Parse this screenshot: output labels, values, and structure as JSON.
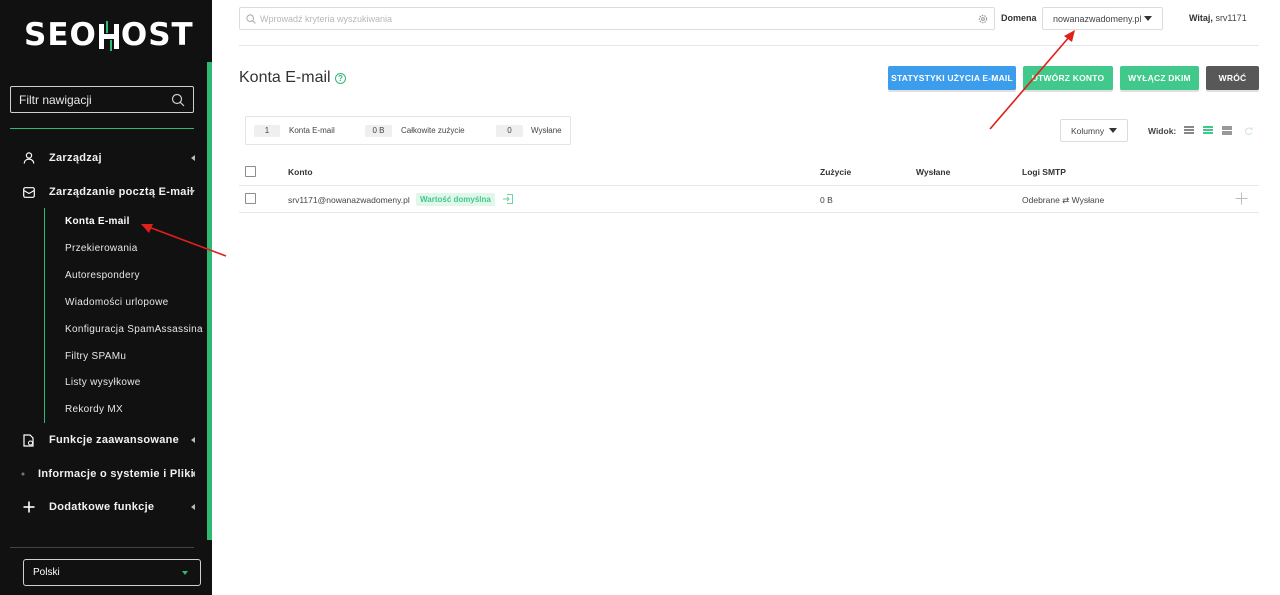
{
  "brand": {
    "logo_left": "SEO",
    "logo_right": "OST",
    "accent": "#2eb872"
  },
  "sidebar": {
    "filter_placeholder": "Filtr nawigacji",
    "items": [
      {
        "label": "Zarządzaj",
        "icon": "user-icon"
      },
      {
        "label": "Zarządzanie pocztą E-mail",
        "icon": "envelope-icon",
        "expanded": true
      },
      {
        "label": "Funkcje zaawansowane",
        "icon": "file-gear-icon"
      },
      {
        "label": "Informacje o systemie i Pliki",
        "icon": "dot-icon"
      },
      {
        "label": "Dodatkowe funkcje",
        "icon": "plus-icon"
      }
    ],
    "submenu": [
      "Konta E-mail",
      "Przekierowania",
      "Autorespondery",
      "Wiadomości urlopowe",
      "Konfiguracja SpamAssassina",
      "Filtry SPAMu",
      "Listy wysyłkowe",
      "Rekordy MX"
    ],
    "active_submenu": "Konta E-mail",
    "language": "Polski"
  },
  "topbar": {
    "search_placeholder": "Wprowadź kryteria wyszukiwania",
    "domain_label": "Domena",
    "domain_value": "nowanazwadomeny.pl",
    "welcome_label": "Witaj,",
    "username": "srv1171"
  },
  "page": {
    "title": "Konta E-mail",
    "buttons": {
      "stats": "STATYSTYKI UŻYCIA E-MAIL",
      "create": "UTWÓRZ KONTO",
      "dkim": "WYŁĄCZ DKIM",
      "back": "WRÓĆ"
    },
    "stats": [
      {
        "value": "1",
        "label": "Konta E-mail"
      },
      {
        "value": "0 B",
        "label": "Całkowite zużycie"
      },
      {
        "value": "0",
        "label": "Wysłane"
      }
    ],
    "columns_button": "Kolumny",
    "view_label": "Widok:"
  },
  "table": {
    "headers": [
      "Konto",
      "Zużycie",
      "Wysłane",
      "Logi SMTP"
    ],
    "rows": [
      {
        "account": "srv1171@nowanazwadomeny.pl",
        "badge": "Wartość domyślna",
        "usage": "0 B",
        "sent": "",
        "smtp_logs": "Odebrane ⇄ Wysłane"
      }
    ]
  },
  "colors": {
    "sidebar_bg": "#111111",
    "blue_button": "#3d9ded",
    "green_button": "#40c98a",
    "gray_button": "#585858",
    "annotation": "#e0201b"
  }
}
